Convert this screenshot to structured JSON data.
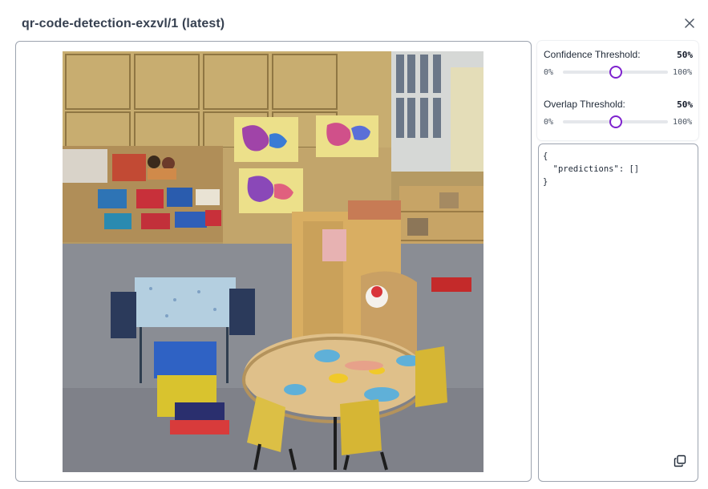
{
  "modal": {
    "title": "qr-code-detection-exzvl/1 (latest)",
    "close_icon": "close-icon"
  },
  "image": {
    "description_icon": "classroom-photo",
    "predictions_drawn": 0
  },
  "settings": {
    "confidence": {
      "label": "Confidence Threshold:",
      "value_text": "50%",
      "min_label": "0%",
      "max_label": "100%",
      "value": 0.5
    },
    "overlap": {
      "label": "Overlap Threshold:",
      "value_text": "50%",
      "min_label": "0%",
      "max_label": "100%",
      "value": 0.5
    },
    "accent_color": "#7e22ce"
  },
  "output": {
    "json_text": "{\n  \"predictions\": []\n}",
    "copy_icon": "copy-icon"
  }
}
